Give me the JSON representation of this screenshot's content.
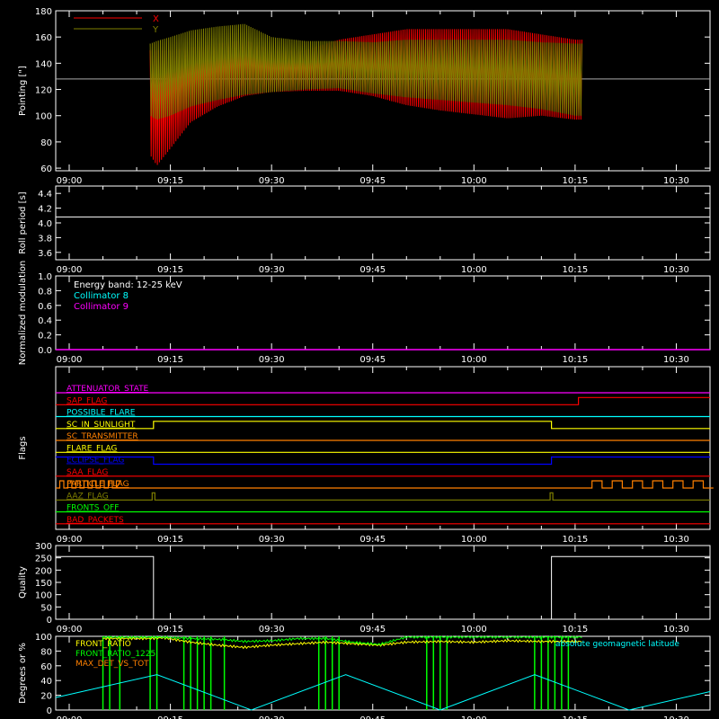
{
  "time_axis": {
    "ticks": [
      "09:00",
      "09:15",
      "09:30",
      "09:45",
      "10:00",
      "10:15",
      "10:30"
    ],
    "tick_minutes": [
      0,
      15,
      30,
      45,
      60,
      75,
      90
    ],
    "range_minutes": [
      -2,
      95
    ],
    "minor_every": 5
  },
  "chart_data": [
    {
      "type": "line",
      "id": "pointing",
      "ylabel": "Pointing [\"]",
      "ylim": [
        58,
        180
      ],
      "yticks": [
        60,
        80,
        100,
        120,
        140,
        160,
        180
      ],
      "reference_line": 128,
      "legend": [
        {
          "name": "X",
          "color": "#ff0000"
        },
        {
          "name": "Y",
          "color": "#808000"
        }
      ],
      "series": [
        {
          "name": "X",
          "color": "#ff0000",
          "t": [
            12,
            13,
            15,
            18,
            22,
            26,
            30,
            35,
            40,
            45,
            50,
            55,
            60,
            65,
            70,
            75,
            76
          ],
          "upper": [
            150,
            150,
            150,
            152,
            155,
            158,
            150,
            150,
            158,
            162,
            166,
            166,
            166,
            166,
            162,
            158,
            158
          ],
          "lower": [
            70,
            62,
            75,
            95,
            107,
            115,
            118,
            119,
            119,
            115,
            108,
            104,
            101,
            98,
            100,
            97,
            97
          ]
        },
        {
          "name": "Y",
          "color": "#808000",
          "t": [
            12,
            13,
            15,
            18,
            22,
            26,
            30,
            35,
            40,
            45,
            50,
            55,
            60,
            65,
            70,
            75,
            76
          ],
          "upper": [
            155,
            157,
            160,
            165,
            168,
            170,
            160,
            157,
            157,
            156,
            158,
            158,
            158,
            158,
            156,
            155,
            155
          ],
          "lower": [
            100,
            97,
            100,
            107,
            112,
            116,
            118,
            120,
            121,
            117,
            114,
            112,
            110,
            108,
            105,
            100,
            100
          ]
        }
      ]
    },
    {
      "type": "line",
      "id": "roll",
      "ylabel": "Roll period [s]",
      "ylim": [
        3.5,
        4.5
      ],
      "yticks": [
        3.6,
        3.8,
        4.0,
        4.2,
        4.4
      ],
      "series": [
        {
          "name": "",
          "color": "#ffffff",
          "t": [
            -2,
            95
          ],
          "values": [
            4.08,
            4.08
          ]
        }
      ]
    },
    {
      "type": "line",
      "id": "modulation",
      "ylabel": "Normalized modulation",
      "ylim": [
        0,
        1.0
      ],
      "yticks": [
        0.0,
        0.2,
        0.4,
        0.6,
        0.8,
        1.0
      ],
      "legend": [
        {
          "name": "Energy band: 12-25 keV",
          "color": "#ffffff"
        },
        {
          "name": "Collimator 8",
          "color": "#00ffff"
        },
        {
          "name": "Collimator 9",
          "color": "#ff00ff"
        }
      ],
      "series": [
        {
          "name": "Collimator 9",
          "color": "#ff00ff",
          "t": [
            -2,
            95
          ],
          "values": [
            0,
            0
          ]
        }
      ]
    },
    {
      "type": "line",
      "id": "flags",
      "ylabel": "Flags",
      "rows": [
        {
          "name": "ATTENUATOR_STATE",
          "color": "#ff00ff",
          "segments": [
            [
              -2,
              95,
              0
            ]
          ]
        },
        {
          "name": "SAP_FLAG",
          "color": "#ff0000",
          "segments": [
            [
              -2,
              75.5,
              0
            ],
            [
              75.5,
              95,
              1
            ]
          ]
        },
        {
          "name": "POSSIBLE_FLARE",
          "color": "#00ffff",
          "segments": [
            [
              -2,
              95,
              0
            ]
          ]
        },
        {
          "name": "SC_IN_SUNLIGHT",
          "color": "#ffff00",
          "segments": [
            [
              -2,
              12.5,
              0
            ],
            [
              12.5,
              71.5,
              1
            ],
            [
              71.5,
              95,
              0
            ]
          ]
        },
        {
          "name": "SC_TRANSMITTER",
          "color": "#ff8000",
          "segments": [
            [
              -2,
              95,
              0
            ]
          ]
        },
        {
          "name": "FLARE_FLAG",
          "color": "#ffff00",
          "segments": [
            [
              -2,
              95,
              0
            ]
          ]
        },
        {
          "name": "ECLIPSE_FLAG",
          "color": "#0000ff",
          "segments": [
            [
              -2,
              12.5,
              1
            ],
            [
              12.5,
              71.5,
              0
            ],
            [
              71.5,
              95,
              1
            ]
          ]
        },
        {
          "name": "SAA_FLAG",
          "color": "#ff0000",
          "segments": [
            [
              -2,
              95,
              0
            ]
          ]
        },
        {
          "name": "PARTICLE_FLAG",
          "color": "#ff8000",
          "toggles": [
            -2,
            7
          ],
          "toggles_end": [
            76,
            95
          ]
        },
        {
          "name": "AAZ_FLAG",
          "color": "#808000",
          "spikes": [
            12.3,
            71.3
          ]
        },
        {
          "name": "FRONTS_OFF",
          "color": "#00ff00",
          "segments": [
            [
              -2,
              95,
              0
            ]
          ]
        },
        {
          "name": "BAD_PACKETS",
          "color": "#ff0000",
          "segments": [
            [
              -2,
              95,
              0
            ]
          ]
        }
      ]
    },
    {
      "type": "line",
      "id": "quality",
      "ylabel": "Quality",
      "ylim": [
        0,
        300
      ],
      "yticks": [
        0,
        50,
        100,
        150,
        200,
        250,
        300
      ],
      "series": [
        {
          "name": "",
          "color": "#ffffff",
          "t": [
            -2,
            12.5,
            12.5,
            71.5,
            71.5,
            95
          ],
          "values": [
            255,
            255,
            0,
            0,
            255,
            255
          ]
        }
      ]
    },
    {
      "type": "line",
      "id": "degrees",
      "ylabel": "Degrees or %",
      "ylim": [
        0,
        100
      ],
      "yticks": [
        0,
        20,
        40,
        60,
        80,
        100
      ],
      "legend": [
        {
          "name": "FRONT_RATIO",
          "color": "#ffff00"
        },
        {
          "name": "FRONT_RATIO_1225",
          "color": "#00ff00"
        },
        {
          "name": "MAX_DET_VS_TOT",
          "color": "#ff8000"
        }
      ],
      "side_label": {
        "text": "absolute geomagnetic latitude",
        "color": "#00ffff"
      },
      "series": [
        {
          "name": "FRONT_RATIO",
          "color": "#ffff00",
          "t": [
            5,
            12,
            14,
            18,
            22,
            26,
            30,
            34,
            38,
            42,
            46,
            50,
            55,
            60,
            65,
            70,
            72,
            76
          ],
          "values": [
            97,
            97,
            98,
            92,
            88,
            85,
            88,
            90,
            92,
            90,
            88,
            92,
            93,
            92,
            94,
            93,
            93,
            93
          ]
        },
        {
          "name": "FRONT_RATIO_1225",
          "color": "#00ff00",
          "t": [
            5,
            12,
            14,
            18,
            22,
            26,
            30,
            34,
            38,
            42,
            46,
            50,
            55,
            60,
            65,
            70,
            72,
            76
          ],
          "values": [
            99,
            99,
            99,
            97,
            96,
            93,
            94,
            97,
            97,
            92,
            89,
            99,
            99,
            99,
            99,
            99,
            99,
            99
          ]
        },
        {
          "name": "absolute geomagnetic latitude",
          "color": "#00ffff",
          "t": [
            -2,
            13,
            27,
            41,
            55,
            69,
            83,
            95
          ],
          "values": [
            17,
            48,
            0,
            48,
            0,
            48,
            0,
            25
          ]
        }
      ],
      "green_spikes": [
        5,
        6,
        7.5,
        12,
        13,
        17,
        18,
        19,
        20,
        21,
        23,
        37,
        38,
        39,
        40,
        53,
        54,
        55,
        56,
        69,
        70,
        71,
        72,
        73,
        74
      ]
    }
  ]
}
